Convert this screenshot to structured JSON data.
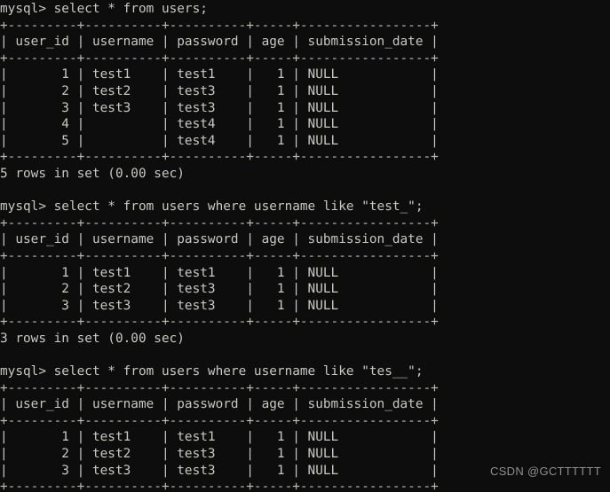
{
  "terminal": {
    "prompt": "mysql> ",
    "background_color": "#0d0d0d",
    "text_color": "#c9c9c1",
    "rule_color": "#b9b7ae",
    "columns": [
      {
        "name": "user_id",
        "width": 9,
        "align": "right"
      },
      {
        "name": "username",
        "width": 10,
        "align": "left"
      },
      {
        "name": "password",
        "width": 10,
        "align": "left"
      },
      {
        "name": "age",
        "width": 5,
        "align": "right"
      },
      {
        "name": "submission_date",
        "width": 17,
        "align": "left"
      }
    ],
    "blocks": [
      {
        "command": "select * from users;",
        "rows": [
          [
            "1",
            "test1",
            "test1",
            "1",
            "NULL"
          ],
          [
            "2",
            "test2",
            "test3",
            "1",
            "NULL"
          ],
          [
            "3",
            "test3",
            "test3",
            "1",
            "NULL"
          ],
          [
            "4",
            "",
            "test4",
            "1",
            "NULL"
          ],
          [
            "5",
            "",
            "test4",
            "1",
            "NULL"
          ]
        ],
        "status": "5 rows in set (0.00 sec)"
      },
      {
        "command": "select * from users where username like \"test_\";",
        "rows": [
          [
            "1",
            "test1",
            "test1",
            "1",
            "NULL"
          ],
          [
            "2",
            "test2",
            "test3",
            "1",
            "NULL"
          ],
          [
            "3",
            "test3",
            "test3",
            "1",
            "NULL"
          ]
        ],
        "status": "3 rows in set (0.00 sec)"
      },
      {
        "command": "select * from users where username like \"tes__\";",
        "rows": [
          [
            "1",
            "test1",
            "test1",
            "1",
            "NULL"
          ],
          [
            "2",
            "test2",
            "test3",
            "1",
            "NULL"
          ],
          [
            "3",
            "test3",
            "test3",
            "1",
            "NULL"
          ]
        ],
        "status": ""
      }
    ]
  },
  "watermark": {
    "text": "CSDN @GCTTTTTT"
  }
}
